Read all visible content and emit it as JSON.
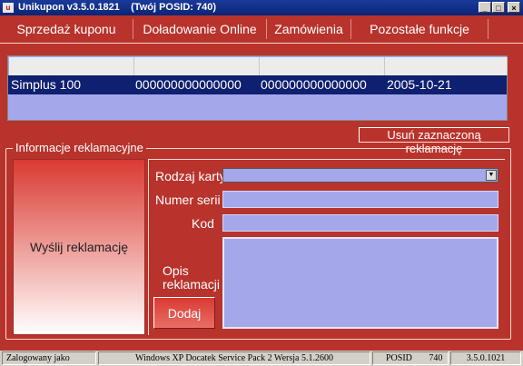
{
  "window": {
    "title": "Unikupon v3.5.0.1821",
    "posid_title": "(Twój POSID: 740)",
    "minimize": "_",
    "maximize": "□",
    "close": "×"
  },
  "menu": {
    "items": [
      {
        "label": "Sprzedaż kuponu"
      },
      {
        "label": "Doładowanie Online"
      },
      {
        "label": "Zamówienia"
      },
      {
        "label": "Pozostałe funkcje"
      }
    ]
  },
  "list": {
    "headers": [
      "",
      "",
      "",
      ""
    ],
    "rows": [
      [
        "Simplus 100",
        "000000000000000",
        "000000000000000",
        "2005-10-21"
      ]
    ],
    "selected_row": 0
  },
  "buttons": {
    "delete_selected": "Usuń zaznaczoną reklamację",
    "send_complaint": "Wyślij reklamację",
    "add": "Dodaj"
  },
  "complaint": {
    "group_title": "Informacje reklamacyjne",
    "card_type_label": "Rodzaj karty",
    "card_type_value": "",
    "serial_label": "Numer serii",
    "serial_value": "",
    "code_label": "Kod",
    "code_value": "",
    "desc_label_1": "Opis",
    "desc_label_2": "reklamacji",
    "desc_value": ""
  },
  "status": {
    "logged_as": "Zalogowany jako",
    "os": "Windows XP Docatek Service Pack 2 Wersja 5.1.2600",
    "posid_label": "POSID",
    "posid_value": "740",
    "version": "3.5.0.1021"
  },
  "colors": {
    "accent": "#b8332c",
    "list_bg": "#a4a8ea",
    "selection": "#102070",
    "titlebar": "#0a2476"
  }
}
